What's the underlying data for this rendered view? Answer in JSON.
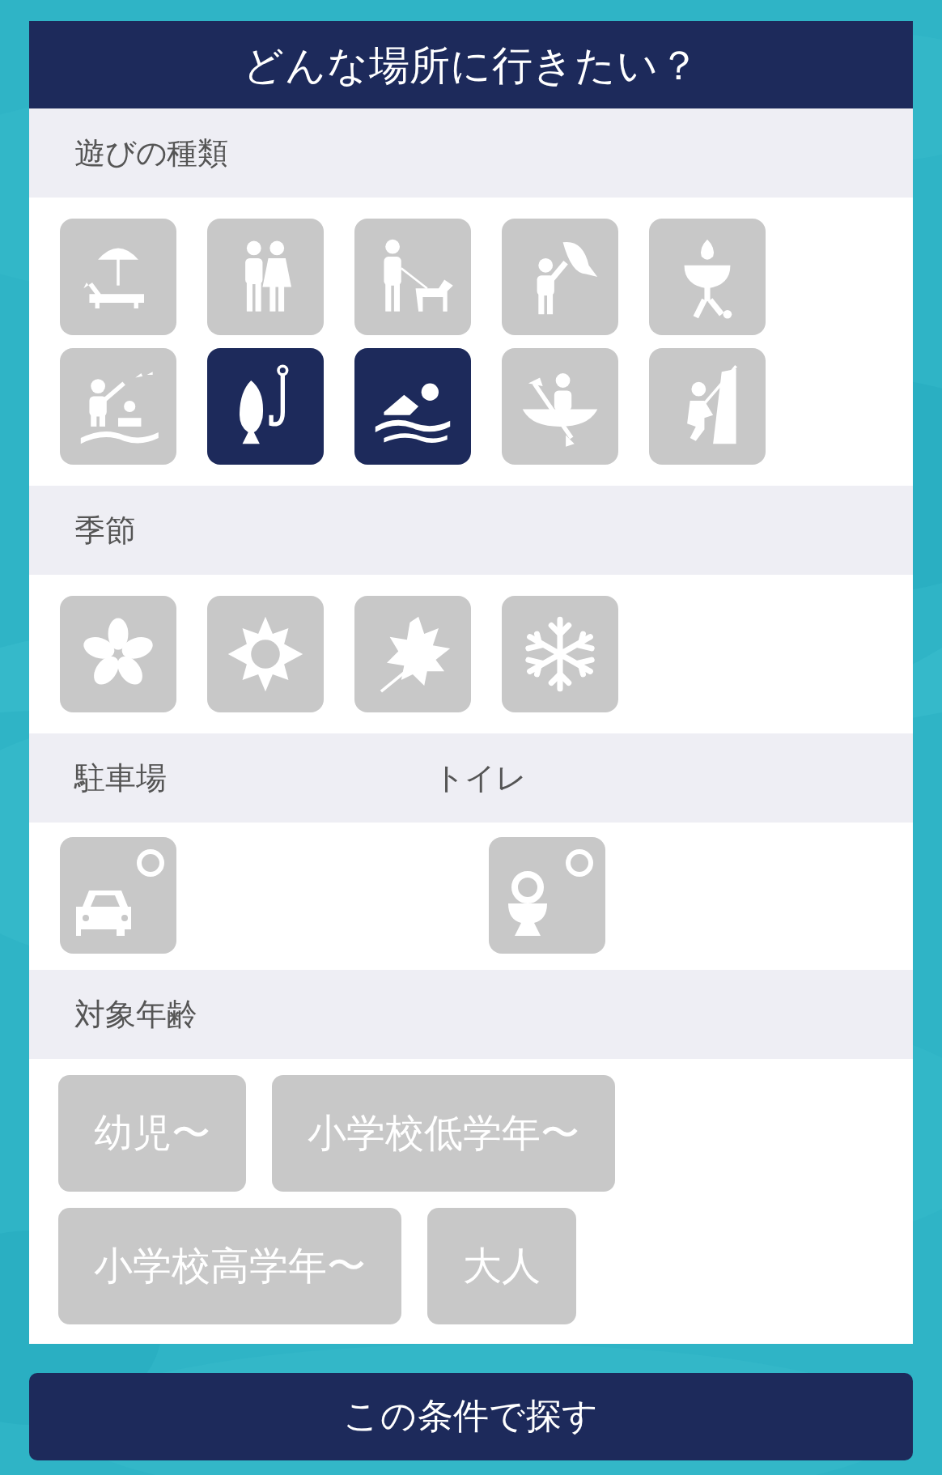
{
  "title": "どんな場所に行きたい？",
  "sections": [
    {
      "kind": "icons",
      "heading": "遊びの種類",
      "items": [
        {
          "kind": "lounger",
          "selected": false
        },
        {
          "kind": "couple",
          "selected": false
        },
        {
          "kind": "dog-walk",
          "selected": false
        },
        {
          "kind": "fish-catch",
          "selected": false
        },
        {
          "kind": "barbecue",
          "selected": false
        },
        {
          "kind": "water-play",
          "selected": false
        },
        {
          "kind": "fishing",
          "selected": true
        },
        {
          "kind": "swimming",
          "selected": true
        },
        {
          "kind": "canoe",
          "selected": false
        },
        {
          "kind": "climbing",
          "selected": false
        }
      ]
    },
    {
      "kind": "icons",
      "heading": "季節",
      "items": [
        {
          "kind": "flower",
          "selected": false
        },
        {
          "kind": "sun",
          "selected": false
        },
        {
          "kind": "leaf",
          "selected": false
        },
        {
          "kind": "snowflake",
          "selected": false
        }
      ]
    },
    {
      "kind": "facilities",
      "items": [
        {
          "heading": "駐車場",
          "kind": "car",
          "available": true,
          "selected": false
        },
        {
          "heading": "トイレ",
          "kind": "toilet",
          "available": true,
          "selected": false
        }
      ]
    },
    {
      "kind": "ages",
      "heading": "対象年齢",
      "items": [
        {
          "label": "幼児〜",
          "selected": false
        },
        {
          "label": "小学校低学年〜",
          "selected": false
        },
        {
          "label": "小学校高学年〜",
          "selected": false
        },
        {
          "label": "大人",
          "selected": false
        }
      ]
    }
  ],
  "search_button": "この条件で探す"
}
